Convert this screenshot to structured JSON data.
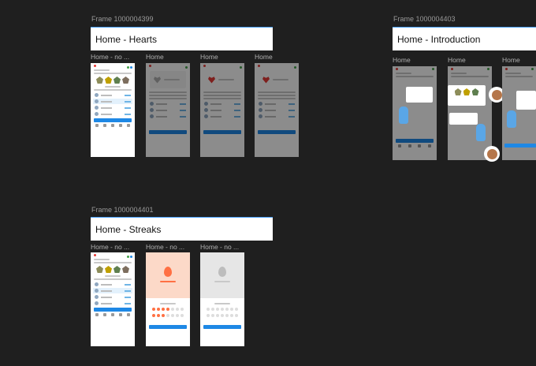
{
  "frames": [
    {
      "label": "Frame 1000004399",
      "title": "Home - Hearts",
      "screens": [
        "Home - no ...",
        "Home",
        "Home",
        "Home"
      ]
    },
    {
      "label": "Frame 1000004403",
      "title": "Home  -  Introduction",
      "screens": [
        "Home",
        "Home",
        "Home"
      ]
    },
    {
      "label": "Frame 1000004401",
      "title": "Home - Streaks",
      "screens": [
        "Home - no ...",
        "Home - no ...",
        "Home - no ..."
      ]
    }
  ],
  "colors": {
    "canvas": "#1f1f1f",
    "accent": "#1e88e5",
    "heart": "#e53935",
    "streak": "#ff7043",
    "mascot": "#5aa6e6"
  }
}
